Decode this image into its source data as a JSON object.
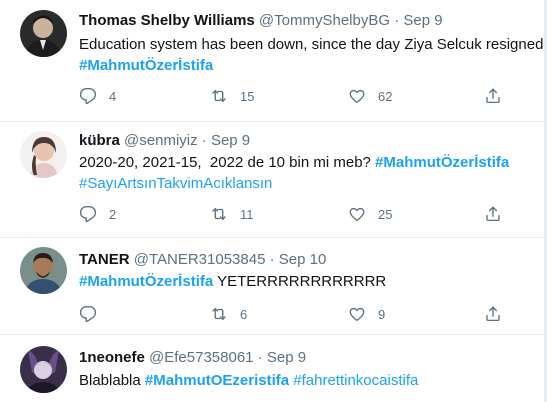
{
  "tweets": [
    {
      "name": "Thomas Shelby Williams",
      "handle": "@TommyShelbyBG",
      "dot": "·",
      "date": "Sep 9",
      "line1": "Education system has been down, since the day Ziya Selcuk resigned",
      "line2_tag": "#MahmutÖzerİstifa",
      "reply_count": "4",
      "retweet_count": "15",
      "like_count": "62"
    },
    {
      "name": "kübra",
      "handle": "@senmiyiz",
      "dot": "·",
      "date": "Sep 9",
      "line1_text": "2020-20, 2021-15,  2022 de 10 bin mi meb? ",
      "line1_tag": "#MahmutÖzerİstifa",
      "line2_tag": "#SayıArtsınTakvimAcıklansın",
      "reply_count": "2",
      "retweet_count": "11",
      "like_count": "25"
    },
    {
      "name": "TANER",
      "handle": "@TANER31053845",
      "dot": "·",
      "date": "Sep 10",
      "line1_tag": "#MahmutÖzerİstifa",
      "line1_text": " YETERRRRRRRRRRRR",
      "retweet_count": "6",
      "like_count": "9"
    },
    {
      "name": "1neonefe",
      "handle": "@Efe57358061",
      "dot": "·",
      "date": "Sep 9",
      "line1_text": "Blablabla ",
      "line1_tag1": "#MahmutOEzeristifa",
      "line1_tag2": " #fahrettinkocaistifa"
    }
  ],
  "icons": {
    "reply": "reply-icon",
    "retweet": "retweet-icon",
    "like": "like-icon",
    "share": "share-icon"
  },
  "colors": {
    "link": "#1da1f2",
    "meta": "#5b7083",
    "text": "#0f1419",
    "divider": "#e6ecf0"
  }
}
